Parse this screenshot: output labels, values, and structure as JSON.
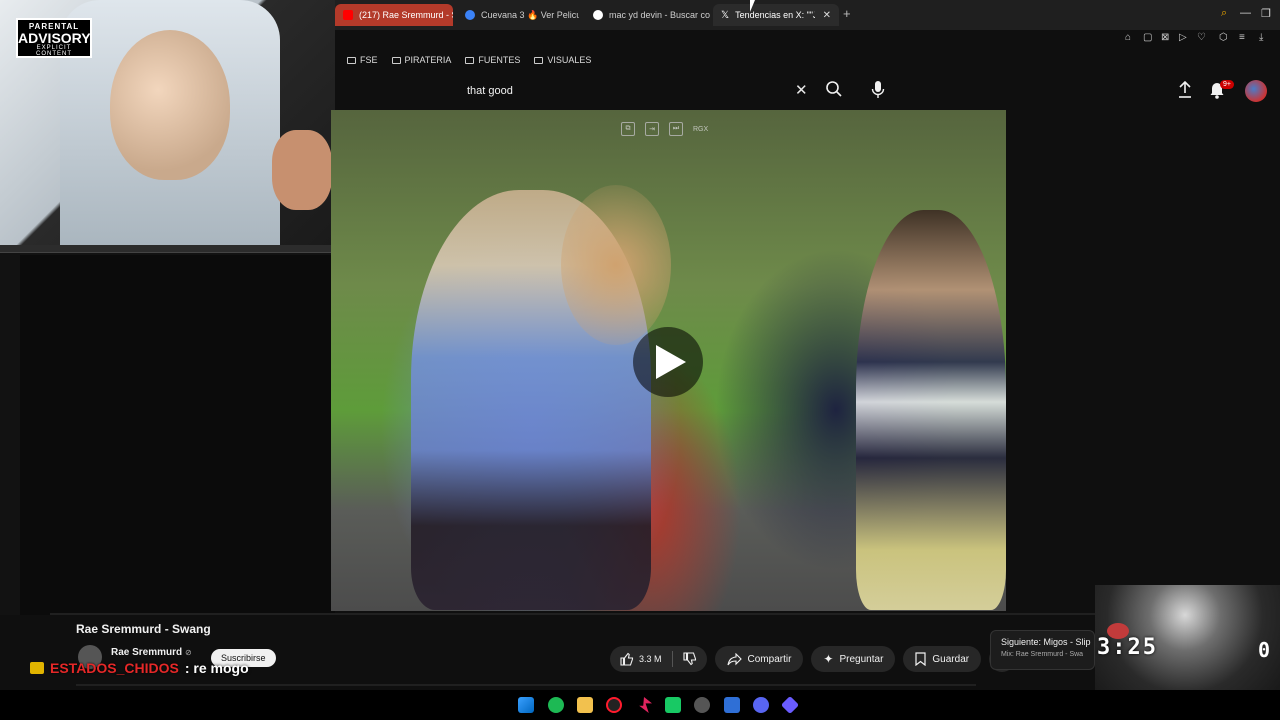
{
  "overlay": {
    "advisory": {
      "top": "PARENTAL",
      "main": "ADVISORY",
      "bottom": "EXPLICIT CONTENT"
    }
  },
  "browser": {
    "tabs": [
      {
        "label": "(217) Rae Sremmurd - Sw",
        "icon": "youtube-icon",
        "color": "#ff0000"
      },
      {
        "label": "Cuevana 3 🔥 Ver Pelicul",
        "icon": "cuevana-icon",
        "color": "#3b82f6"
      },
      {
        "label": "mac yd devin - Buscar co",
        "icon": "google-icon",
        "color": "#ffffff"
      },
      {
        "label": "Tendencias en X: \"\"Ju",
        "icon": "x-icon",
        "color": "#000000"
      }
    ],
    "new_tab": "+",
    "window_controls": {
      "search": "⌕",
      "minimize": "—",
      "restore": "❐"
    }
  },
  "bookmarks": [
    {
      "label": "FSE"
    },
    {
      "label": "PIRATERIA"
    },
    {
      "label": "FUENTES"
    },
    {
      "label": "VISUALES"
    }
  ],
  "header": {
    "search_value": "that good",
    "clear_label": "✕",
    "notifications_badge": "9+"
  },
  "player": {
    "controls": {
      "rgx": "RGX"
    },
    "play_state": "paused"
  },
  "video": {
    "title": "Rae Sremmurd - Swang",
    "channel": "Rae Sremmurd",
    "verified_mark": "⊘",
    "subscribe_label": "Suscribirse",
    "likes": "3.3 M",
    "share_label": "Compartir",
    "ask_label": "Preguntar",
    "save_label": "Guardar",
    "more_label": "•••"
  },
  "chat": {
    "user": "ESTADOS_CHIDOS",
    "message": ": re mogo"
  },
  "next_up": {
    "title": "Siguiente: Migos - Slip",
    "subtitle": "Mix: Rae Sremmurd - Swa"
  },
  "stream": {
    "timer": "3:25",
    "timer_right": "0"
  },
  "colors": {
    "accent": "#cc0000",
    "chat_user": "#e52828",
    "background": "#0f0f0f"
  }
}
